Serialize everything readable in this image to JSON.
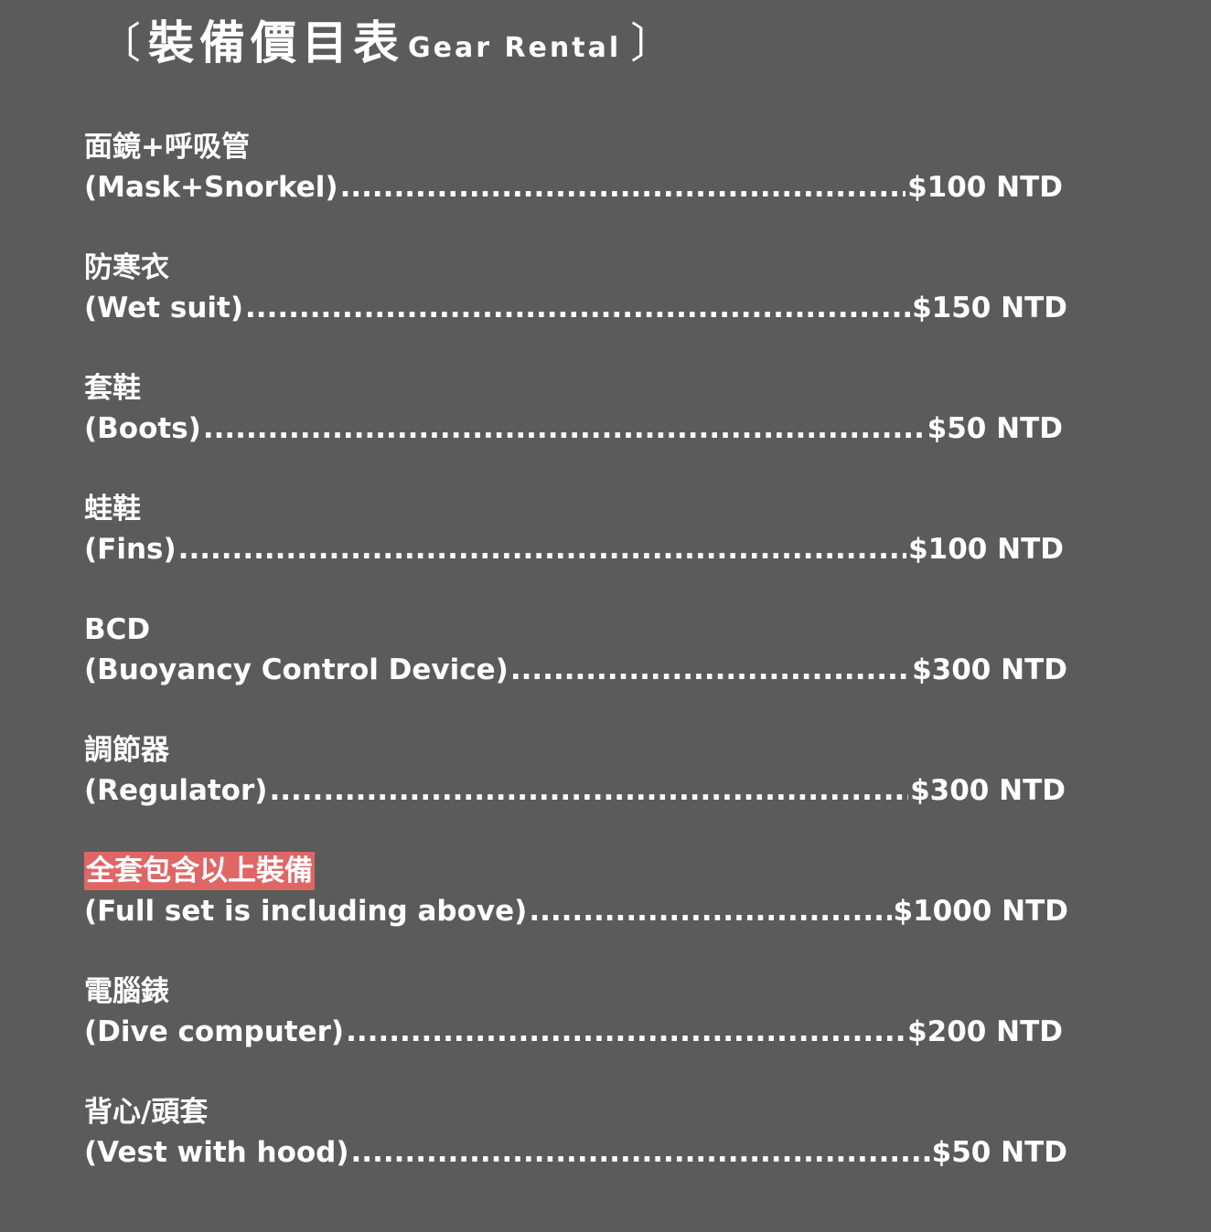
{
  "header": {
    "bracket_left": "〔",
    "title_zh": "裝備價目表",
    "title_en": "Gear Rental",
    "bracket_right": "〕"
  },
  "leader": "................................................................................................................................................................................",
  "items": [
    {
      "zh": "面鏡+呼吸管",
      "en": "(Mask+Snorkel)",
      "price": "$100 NTD",
      "row_width": 1070,
      "highlight": false
    },
    {
      "zh": "防寒衣",
      "en": "(Wet suit)",
      "price": "$150 NTD",
      "row_width": 1075,
      "highlight": false
    },
    {
      "zh": "套鞋",
      "en": "(Boots)",
      "price": "$50 NTD",
      "row_width": 1070,
      "highlight": false
    },
    {
      "zh": "蛙鞋",
      "en": "(Fins)",
      "price": "$100 NTD",
      "row_width": 1071,
      "highlight": false
    },
    {
      "zh": "BCD",
      "en": "(Buoyancy Control Device)",
      "price": "$300 NTD",
      "row_width": 1075,
      "highlight": false
    },
    {
      "zh": "調節器",
      "en": "(Regulator)",
      "price": "$300 NTD",
      "row_width": 1073,
      "highlight": false
    },
    {
      "zh": "全套包含以上裝備",
      "en": "(Full set is including above)",
      "price": "$1000 NTD",
      "row_width": 1076,
      "highlight": true
    },
    {
      "zh": "電腦錶",
      "en": "(Dive computer)",
      "price": "$200 NTD",
      "row_width": 1070,
      "highlight": false
    },
    {
      "zh": "背心/頭套",
      "en": "(Vest with hood)",
      "price": "$50 NTD",
      "row_width": 1075,
      "highlight": false
    }
  ]
}
